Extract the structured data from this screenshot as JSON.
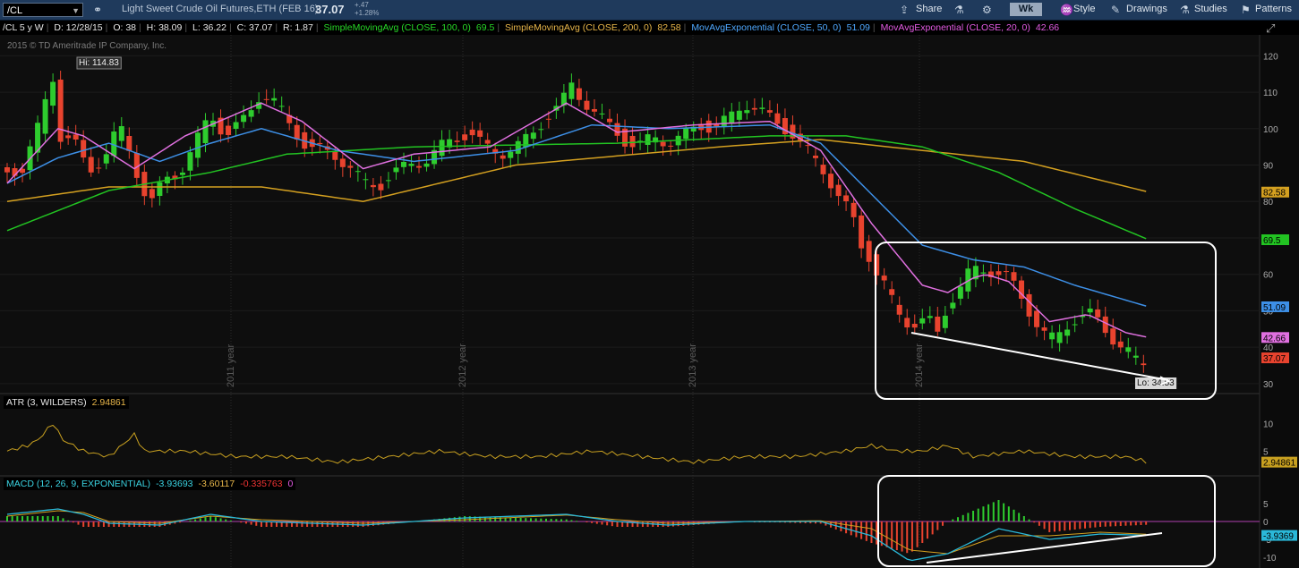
{
  "toolbar": {
    "symbol": "/CL",
    "description": "Light Sweet Crude Oil Futures,ETH (FEB 16)",
    "last": "37.07",
    "change_abs": "+.47",
    "change_pct": "+1.28%",
    "share": "Share",
    "timeframe": "Wk",
    "style": "Style",
    "drawings": "Drawings",
    "studies": "Studies",
    "patterns": "Patterns"
  },
  "infobar": {
    "chart_id": "/CL 5 y W",
    "date": "D: 12/28/15",
    "open": "O: 38",
    "high": "H: 38.09",
    "low": "L: 36.22",
    "close": "C: 37.07",
    "range": "R: 1.87",
    "sma100_label": "SimpleMovingAvg (CLOSE, 100, 0)",
    "sma100_value": "69.5",
    "sma200_label": "SimpleMovingAvg (CLOSE, 200, 0)",
    "sma200_value": "82.58",
    "ema50_label": "MovAvgExponential (CLOSE, 50, 0)",
    "ema50_value": "51.09",
    "ema20_label": "MovAvgExponential (CLOSE, 20, 0)",
    "ema20_value": "42.66"
  },
  "copyright": "2015 © TD Ameritrade IP Company, Inc.",
  "atr_bar": {
    "label": "ATR (3, WILDERS)",
    "value": "2.94861"
  },
  "macd_bar": {
    "label": "MACD (12, 26, 9, EXPONENTIAL)",
    "value": "-3.93693",
    "avg": "-3.60117",
    "diff": "-0.335763",
    "zero": "0"
  },
  "colors": {
    "up": "#2ecc2e",
    "down": "#e8432e",
    "sma100": "#22c322",
    "sma200": "#d4a020",
    "ema50": "#3d8fe6",
    "ema20": "#e070e0",
    "atr": "#c8a020",
    "macd": "#2ab8d8",
    "macd_avg": "#d4a020"
  },
  "chart_data": [
    {
      "type": "candlestick",
      "y_scale": "price",
      "ylim": [
        28,
        125
      ],
      "y_ticks": [
        30,
        40,
        50,
        60,
        70,
        80,
        90,
        100,
        110,
        120
      ],
      "x_labels": [
        "2011 year",
        "2012 year",
        "2013 year",
        "2014 year"
      ],
      "annotations": {
        "hi": "Hi: 114.83",
        "lo": "Lo: 34.53"
      },
      "value_labels": [
        {
          "text": "82.58",
          "value": 82.58,
          "color": "#d4a020"
        },
        {
          "text": "69.5",
          "value": 69.5,
          "color": "#22c322"
        },
        {
          "text": "51.09",
          "value": 51.09,
          "color": "#3d8fe6"
        },
        {
          "text": "42.66",
          "value": 42.66,
          "color": "#e070e0"
        },
        {
          "text": "37.07",
          "value": 37.07,
          "color": "#e8432e"
        }
      ],
      "close_path": [
        [
          0,
          88
        ],
        [
          6,
          89
        ],
        [
          12,
          100
        ],
        [
          16,
          110
        ],
        [
          18,
          114
        ],
        [
          20,
          98
        ],
        [
          26,
          97
        ],
        [
          32,
          88
        ],
        [
          38,
          92
        ],
        [
          44,
          101
        ],
        [
          48,
          94
        ],
        [
          52,
          86
        ],
        [
          56,
          79
        ],
        [
          62,
          86
        ],
        [
          68,
          88
        ],
        [
          74,
          96
        ],
        [
          80,
          104
        ],
        [
          86,
          98
        ],
        [
          94,
          103
        ],
        [
          100,
          110
        ],
        [
          106,
          107
        ],
        [
          112,
          100
        ],
        [
          118,
          95
        ],
        [
          124,
          94
        ],
        [
          130,
          92
        ],
        [
          136,
          89
        ],
        [
          140,
          85
        ],
        [
          146,
          84
        ],
        [
          152,
          88
        ],
        [
          158,
          90
        ],
        [
          164,
          91
        ],
        [
          170,
          95
        ],
        [
          176,
          97
        ],
        [
          182,
          99
        ],
        [
          188,
          95
        ],
        [
          194,
          93
        ],
        [
          200,
          95
        ],
        [
          206,
          98
        ],
        [
          212,
          103
        ],
        [
          218,
          107
        ],
        [
          222,
          112
        ],
        [
          226,
          108
        ],
        [
          232,
          104
        ],
        [
          238,
          100
        ],
        [
          244,
          96
        ],
        [
          248,
          95
        ],
        [
          254,
          98
        ],
        [
          260,
          96
        ],
        [
          266,
          98
        ],
        [
          272,
          101
        ],
        [
          278,
          100
        ],
        [
          284,
          103
        ],
        [
          290,
          107
        ],
        [
          296,
          105
        ],
        [
          302,
          102
        ],
        [
          308,
          99
        ],
        [
          312,
          96
        ],
        [
          316,
          93
        ],
        [
          320,
          90
        ],
        [
          324,
          85
        ],
        [
          328,
          80
        ],
        [
          332,
          77
        ],
        [
          336,
          68
        ],
        [
          340,
          64
        ],
        [
          342,
          60
        ],
        [
          346,
          56
        ],
        [
          350,
          50
        ],
        [
          354,
          47
        ],
        [
          358,
          46
        ],
        [
          362,
          48
        ],
        [
          366,
          44
        ],
        [
          370,
          52
        ],
        [
          374,
          55
        ],
        [
          378,
          60
        ],
        [
          382,
          62
        ],
        [
          386,
          61
        ],
        [
          390,
          60
        ],
        [
          394,
          59
        ],
        [
          398,
          55
        ],
        [
          402,
          50
        ],
        [
          406,
          45
        ],
        [
          410,
          42
        ],
        [
          414,
          44
        ],
        [
          418,
          47
        ],
        [
          422,
          48
        ],
        [
          426,
          49
        ],
        [
          430,
          47
        ],
        [
          434,
          43
        ],
        [
          438,
          40
        ],
        [
          442,
          38
        ],
        [
          446,
          35
        ],
        [
          449,
          37
        ]
      ],
      "series": [
        {
          "name": "SimpleMovingAvg (CLOSE, 200, 0)",
          "values": [
            [
              0,
              80
            ],
            [
              40,
              84
            ],
            [
              100,
              84
            ],
            [
              140,
              80
            ],
            [
              200,
              90
            ],
            [
              280,
              95
            ],
            [
              320,
              97
            ],
            [
              360,
              94
            ],
            [
              400,
              91
            ],
            [
              449,
              82.58
            ]
          ]
        },
        {
          "name": "SimpleMovingAvg (CLOSE, 100, 0)",
          "values": [
            [
              0,
              72
            ],
            [
              40,
              83
            ],
            [
              80,
              88
            ],
            [
              110,
              93
            ],
            [
              160,
              95
            ],
            [
              240,
              96
            ],
            [
              300,
              98
            ],
            [
              330,
              98
            ],
            [
              360,
              95
            ],
            [
              390,
              88
            ],
            [
              420,
              78
            ],
            [
              449,
              69.5
            ]
          ]
        },
        {
          "name": "MovAvgExponential (CLOSE, 50, 0)",
          "values": [
            [
              0,
              85
            ],
            [
              20,
              92
            ],
            [
              40,
              96
            ],
            [
              60,
              91
            ],
            [
              80,
              96
            ],
            [
              100,
              100
            ],
            [
              130,
              94
            ],
            [
              160,
              91
            ],
            [
              200,
              94
            ],
            [
              230,
              101
            ],
            [
              260,
              100
            ],
            [
              300,
              101
            ],
            [
              320,
              96
            ],
            [
              340,
              82
            ],
            [
              360,
              68
            ],
            [
              380,
              64
            ],
            [
              400,
              62
            ],
            [
              420,
              57
            ],
            [
              449,
              51.09
            ]
          ]
        },
        {
          "name": "MovAvgExponential (CLOSE, 20, 0)",
          "values": [
            [
              0,
              85
            ],
            [
              20,
              100
            ],
            [
              30,
              98
            ],
            [
              50,
              89
            ],
            [
              70,
              98
            ],
            [
              100,
              107
            ],
            [
              116,
              102
            ],
            [
              140,
              89
            ],
            [
              160,
              93
            ],
            [
              190,
              95
            ],
            [
              220,
              107
            ],
            [
              240,
              99
            ],
            [
              270,
              101
            ],
            [
              300,
              102
            ],
            [
              320,
              94
            ],
            [
              340,
              74
            ],
            [
              360,
              57
            ],
            [
              370,
              55
            ],
            [
              380,
              59
            ],
            [
              385,
              60
            ],
            [
              394,
              58
            ],
            [
              410,
              47
            ],
            [
              425,
              49
            ],
            [
              440,
              44
            ],
            [
              449,
              42.66
            ]
          ]
        }
      ]
    },
    {
      "type": "line",
      "name": "ATR (3, WILDERS)",
      "ylim": [
        1,
        12
      ],
      "y_ticks": [
        5,
        10
      ],
      "last_label": "2.94861",
      "values": [
        [
          0,
          5
        ],
        [
          8,
          6
        ],
        [
          12,
          7
        ],
        [
          18,
          10
        ],
        [
          22,
          7
        ],
        [
          30,
          5
        ],
        [
          40,
          4
        ],
        [
          50,
          8
        ],
        [
          54,
          5
        ],
        [
          70,
          5
        ],
        [
          90,
          4
        ],
        [
          110,
          4
        ],
        [
          130,
          3
        ],
        [
          150,
          4
        ],
        [
          170,
          5
        ],
        [
          190,
          4
        ],
        [
          210,
          4
        ],
        [
          230,
          5
        ],
        [
          250,
          4
        ],
        [
          270,
          3
        ],
        [
          290,
          4
        ],
        [
          310,
          4
        ],
        [
          330,
          5
        ],
        [
          340,
          6
        ],
        [
          350,
          5
        ],
        [
          360,
          5
        ],
        [
          370,
          6
        ],
        [
          380,
          4
        ],
        [
          400,
          5
        ],
        [
          420,
          4
        ],
        [
          440,
          4
        ],
        [
          449,
          3
        ]
      ]
    },
    {
      "type": "line",
      "name": "MACD (12, 26, 9, EXPONENTIAL)",
      "ylim": [
        -13,
        8
      ],
      "y_ticks": [
        5,
        0,
        -5,
        -10
      ],
      "last_label": "-3.9369",
      "macd": [
        [
          0,
          2
        ],
        [
          20,
          3.5
        ],
        [
          30,
          2
        ],
        [
          40,
          -0.5
        ],
        [
          60,
          -1
        ],
        [
          80,
          2
        ],
        [
          100,
          0
        ],
        [
          140,
          -1
        ],
        [
          160,
          0
        ],
        [
          180,
          1
        ],
        [
          220,
          2
        ],
        [
          240,
          0
        ],
        [
          260,
          -1
        ],
        [
          290,
          0
        ],
        [
          320,
          0
        ],
        [
          340,
          -4
        ],
        [
          355,
          -11
        ],
        [
          370,
          -9
        ],
        [
          390,
          -2
        ],
        [
          410,
          -5
        ],
        [
          430,
          -3.5
        ],
        [
          449,
          -3.9
        ]
      ],
      "signal": [
        [
          0,
          1.5
        ],
        [
          20,
          3
        ],
        [
          30,
          2.5
        ],
        [
          40,
          0
        ],
        [
          60,
          -0.5
        ],
        [
          80,
          1.5
        ],
        [
          100,
          0.5
        ],
        [
          140,
          -0.5
        ],
        [
          160,
          0
        ],
        [
          180,
          0.5
        ],
        [
          220,
          1.8
        ],
        [
          240,
          0.5
        ],
        [
          260,
          -0.5
        ],
        [
          290,
          0
        ],
        [
          320,
          0.2
        ],
        [
          340,
          -2
        ],
        [
          355,
          -8
        ],
        [
          370,
          -9
        ],
        [
          390,
          -4
        ],
        [
          410,
          -4
        ],
        [
          430,
          -3
        ],
        [
          449,
          -3.6
        ]
      ]
    }
  ]
}
